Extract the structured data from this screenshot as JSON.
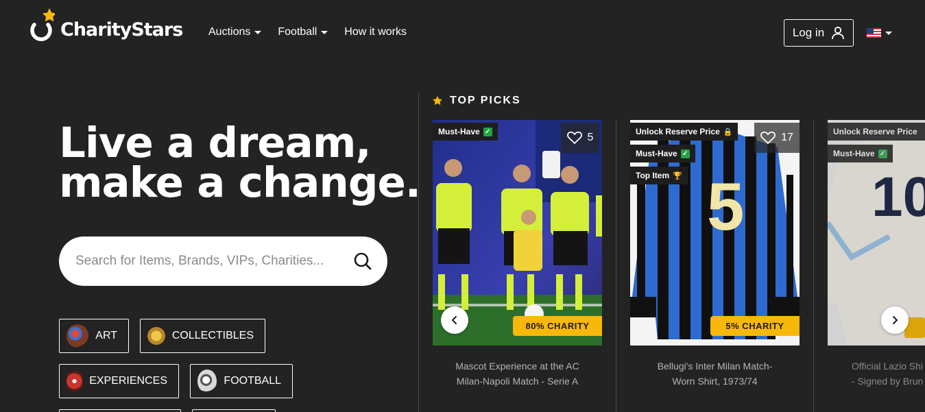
{
  "header": {
    "logo_text": "CharityStars",
    "nav": [
      {
        "label": "Auctions",
        "dropdown": true
      },
      {
        "label": "Football",
        "dropdown": true
      },
      {
        "label": "How it works",
        "dropdown": false
      }
    ],
    "login_label": "Log in",
    "language": "us-flag-icon"
  },
  "hero": {
    "title_line1": "Live a dream,",
    "title_line2": "make a change.",
    "search_placeholder": "Search for Items, Brands, VIPs, Charities..."
  },
  "categories": [
    {
      "label": "ART",
      "icon": "palette-icon"
    },
    {
      "label": "COLLECTIBLES",
      "icon": "medal-icon"
    },
    {
      "label": "EXPERIENCES",
      "icon": "ticket-icon"
    },
    {
      "label": "FOOTBALL",
      "icon": "football-icon"
    }
  ],
  "top_picks": {
    "heading": "TOP PICKS",
    "cards": [
      {
        "badges": [
          "Must-Have"
        ],
        "likes": "5",
        "charity": "80% CHARITY",
        "title_line1": "Mascot Experience at the AC",
        "title_line2": "Milan-Napoli Match - Serie A"
      },
      {
        "badges": [
          "Unlock Reserve Price",
          "Must-Have",
          "Top Item"
        ],
        "likes": "17",
        "charity": "5% CHARITY",
        "title_line1": "Bellugi's Inter Milan Match-",
        "title_line2": "Worn Shirt, 1973/74"
      },
      {
        "badges": [
          "Unlock Reserve Price",
          "Must-Have"
        ],
        "likes": "",
        "charity": "",
        "title_line1": "Official Lazio Shi",
        "title_line2": "- Signed by Brun"
      }
    ]
  },
  "colors": {
    "background": "#232323",
    "accent": "#f8b80a",
    "check": "#23a341"
  }
}
